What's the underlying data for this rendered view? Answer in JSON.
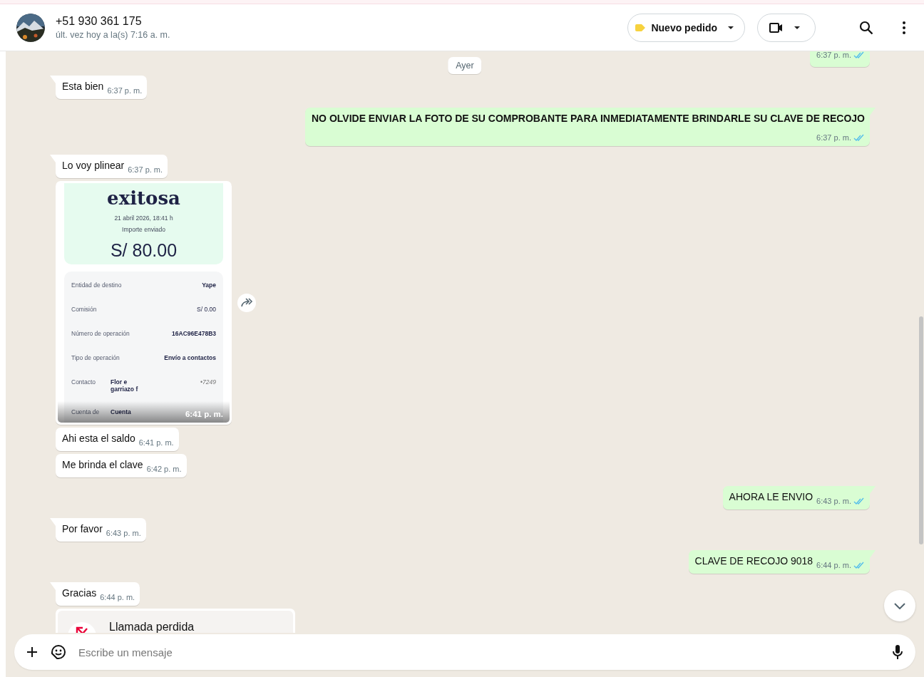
{
  "header": {
    "contact": "+51 930 361 175",
    "status": "últ. vez hoy a la(s) 7:16 a. m.",
    "label_button": {
      "text": "Nuevo pedido",
      "color": "#f7d23e"
    }
  },
  "date_chip": "Ayer",
  "messages": [
    {
      "kind": "text",
      "outgoing": true,
      "tail": false,
      "time": "6:37 p. m.",
      "read": true
    },
    {
      "kind": "text",
      "outgoing": false,
      "tail": true,
      "text": "Esta bien",
      "time": "6:37 p. m."
    },
    {
      "kind": "text",
      "outgoing": true,
      "tail": true,
      "text": "NO OLVIDE ENVIAR LA FOTO DE SU COMPROBANTE PARA INMEDIATAMENTE BRINDARLE SU CLAVE DE RECOJO",
      "bold": true,
      "time": "6:37 p. m.",
      "read": true
    },
    {
      "kind": "text",
      "outgoing": false,
      "tail": true,
      "text": "Lo voy plinear",
      "time": "6:37 p. m."
    },
    {
      "time": "6:41 p. m.",
      "receipt": {
        "title": "exitosa",
        "date": "21 abril 2026, 18:41 h",
        "amount_label": "Importe enviado",
        "amount": "S/ 80.00",
        "rows": [
          {
            "label": "Entidad de destino",
            "value": "Yape",
            "bold": true
          },
          {
            "label": "Comisión",
            "value": "S/ 0.00",
            "bold": false
          },
          {
            "label": "Número de operación",
            "value": "16AC96E478B3",
            "bold": true
          },
          {
            "label": "Tipo de operación",
            "value": "Envío a contactos",
            "bold": true
          },
          {
            "label": "Contacto",
            "value": "Flor e garriazo f",
            "extra": "•7249",
            "bold": true
          },
          {
            "label": "Cuenta de",
            "value": "Cuenta",
            "bold": true
          }
        ]
      }
    },
    {
      "kind": "text",
      "outgoing": false,
      "tail": false,
      "text": "Ahi esta el saldo",
      "time": "6:41 p. m."
    },
    {
      "kind": "text",
      "outgoing": false,
      "tail": false,
      "text": "Me brinda el clave",
      "time": "6:42 p. m."
    },
    {
      "kind": "text",
      "outgoing": true,
      "tail": true,
      "text": "AHORA LE ENVIO",
      "time": "6:43 p. m.",
      "read": true
    },
    {
      "kind": "text",
      "outgoing": false,
      "tail": true,
      "text": "Por favor",
      "time": "6:43 p. m."
    },
    {
      "kind": "text",
      "outgoing": true,
      "tail": true,
      "text": "CLAVE DE RECOJO 9018",
      "time": "6:44 p. m.",
      "read": true
    },
    {
      "kind": "text",
      "outgoing": false,
      "tail": true,
      "text": "Gracias",
      "time": "6:44 p. m."
    },
    {
      "kind": "call",
      "text": "Llamada perdida"
    }
  ],
  "composer": {
    "placeholder": "Escribe un mensaje"
  }
}
